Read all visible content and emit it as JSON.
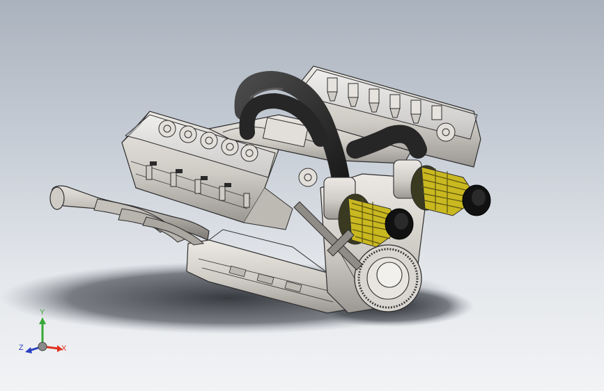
{
  "viewport": {
    "model": "v8-engine-assembly",
    "background_top": "#aab2bd",
    "background_bottom": "#f2f3f5"
  },
  "triad": {
    "x_label": "X",
    "y_label": "Y",
    "z_label": "Z",
    "x_color": "#e03020",
    "y_color": "#38a838",
    "z_color": "#2a3fc0"
  },
  "colors": {
    "hose": "#2b2b2b",
    "filter_yellow": "#c9b820",
    "filter_cap": "#111111",
    "metal_light": "#d7d4cf",
    "metal_mid": "#a9a6a1",
    "metal_dark": "#6b6865",
    "outline": "#2d2d2d",
    "shadow": "#3a3d42"
  }
}
